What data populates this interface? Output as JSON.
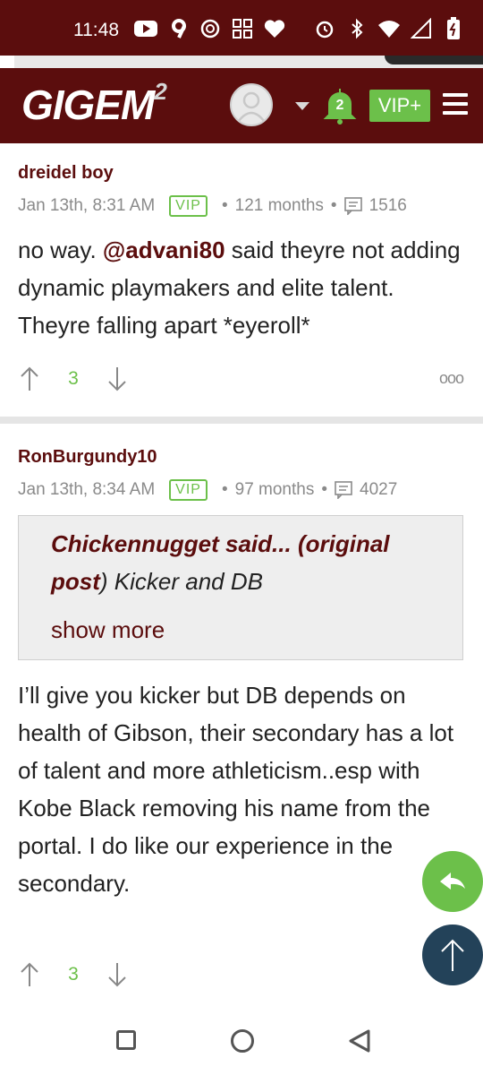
{
  "status_bar": {
    "time": "11:48",
    "left_icons": [
      "youtube-icon",
      "nine-icon",
      "openai-icon",
      "grid-icon",
      "heart-icon"
    ],
    "right_icons": [
      "alarm-icon",
      "bluetooth-icon",
      "wifi-icon",
      "signal-icon",
      "battery-icon"
    ]
  },
  "header": {
    "logo": "GIGEM",
    "logo_sup": "2",
    "notification_count": "2",
    "vip_button": "VIP+"
  },
  "posts": [
    {
      "author": "dreidel boy",
      "date": "Jan 13th, 8:31 AM",
      "badge": "VIP",
      "tenure": "121 months",
      "post_count": "1516",
      "body_prefix": "no way. ",
      "mention": "@advani80",
      "body_suffix": " said theyre not adding dynamic playmakers and elite talent. Theyre falling apart *eyeroll*",
      "votes": "3",
      "more_label": "ooo"
    },
    {
      "author": "RonBurgundy10",
      "date": "Jan 13th, 8:34 AM",
      "badge": "VIP",
      "tenure": "97 months",
      "post_count": "4027",
      "quote": {
        "author": "Chickennugget said...",
        "link_open": " (",
        "link": "original post",
        "link_close": ")",
        "text": " Kicker and DB",
        "show_more": "show more"
      },
      "body": "I’ll give you kicker but DB depends on health of Gibson, their secondary has a lot of talent and more athleticism..esp with Kobe Black removing his name from the portal. I do like our experience in the secondary.",
      "votes": "3"
    }
  ],
  "colors": {
    "brand": "#5b0d0d",
    "accent_green": "#6cc04a",
    "fab_dark": "#234259"
  }
}
